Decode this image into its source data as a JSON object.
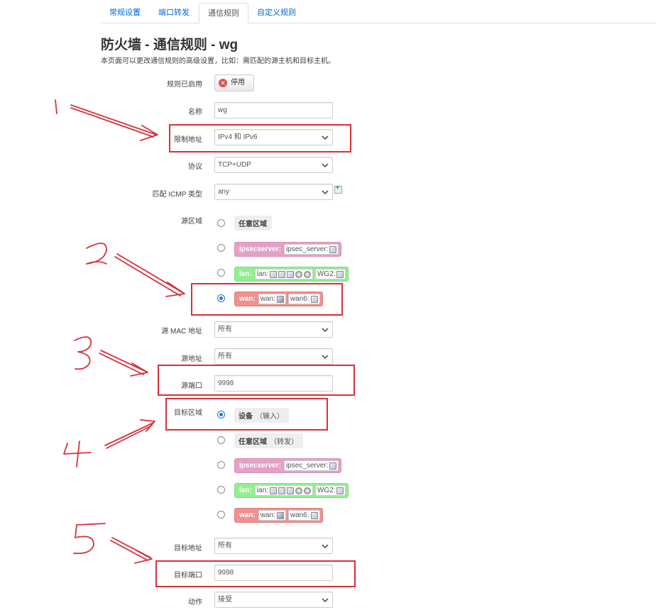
{
  "tabs": [
    {
      "label": "常规设置"
    },
    {
      "label": "端口转发"
    },
    {
      "label": "通信规则"
    },
    {
      "label": "自定义规则"
    }
  ],
  "page": {
    "title": "防火墙 - 通信规则 - wg",
    "description": "本页面可以更改通信规则的高级设置，比如：需匹配的源主机和目标主机。"
  },
  "form": {
    "rule_enabled": {
      "label": "规则已启用",
      "button": "停用"
    },
    "name": {
      "label": "名称",
      "value": "wg"
    },
    "restrict_address": {
      "label": "限制地址",
      "value": "IPv4 和 IPv6"
    },
    "protocol": {
      "label": "协议",
      "value": "TCP+UDP"
    },
    "icmp_type": {
      "label": "匹配 ICMP 类型",
      "value": "any"
    },
    "source_zone": {
      "label": "源区域",
      "options": {
        "any": {
          "name": "任意区域"
        },
        "ipsec": {
          "name": "ipsecserver:",
          "ifaces": [
            "ipsec_server:"
          ]
        },
        "lan": {
          "name": "lan:",
          "ifaces": [
            "lan:",
            "WG2:"
          ]
        },
        "wan": {
          "name": "wan:",
          "ifaces": [
            "wan:",
            "wan6:"
          ]
        }
      },
      "selected": "wan"
    },
    "src_mac": {
      "label": "源 MAC 地址",
      "value": "所有"
    },
    "src_ip": {
      "label": "源地址",
      "value": "所有"
    },
    "src_port": {
      "label": "源端口",
      "value": "9998"
    },
    "dest_zone": {
      "label": "目标区域",
      "options": {
        "device": {
          "name": "设备",
          "suffix": "（输入）"
        },
        "any": {
          "name": "任意区域",
          "suffix": "（转发）"
        },
        "ipsec": {
          "name": "ipsecserver:",
          "ifaces": [
            "ipsec_server:"
          ]
        },
        "lan": {
          "name": "lan:",
          "ifaces": [
            "lan:",
            "WG2:"
          ]
        },
        "wan": {
          "name": "wan:",
          "ifaces": [
            "wan:",
            "wan6:"
          ]
        }
      },
      "selected": "device"
    },
    "dest_ip": {
      "label": "目标地址",
      "value": "所有"
    },
    "dest_port": {
      "label": "目标端口",
      "value": "9998"
    },
    "action": {
      "label": "动作",
      "value": "接受"
    }
  },
  "colors": {
    "link": "#0069d6",
    "zone_ipsec": "#e5a0c6",
    "zone_lan": "#90f090",
    "zone_wan": "#f09090",
    "annotation_red": "#d9303a"
  }
}
